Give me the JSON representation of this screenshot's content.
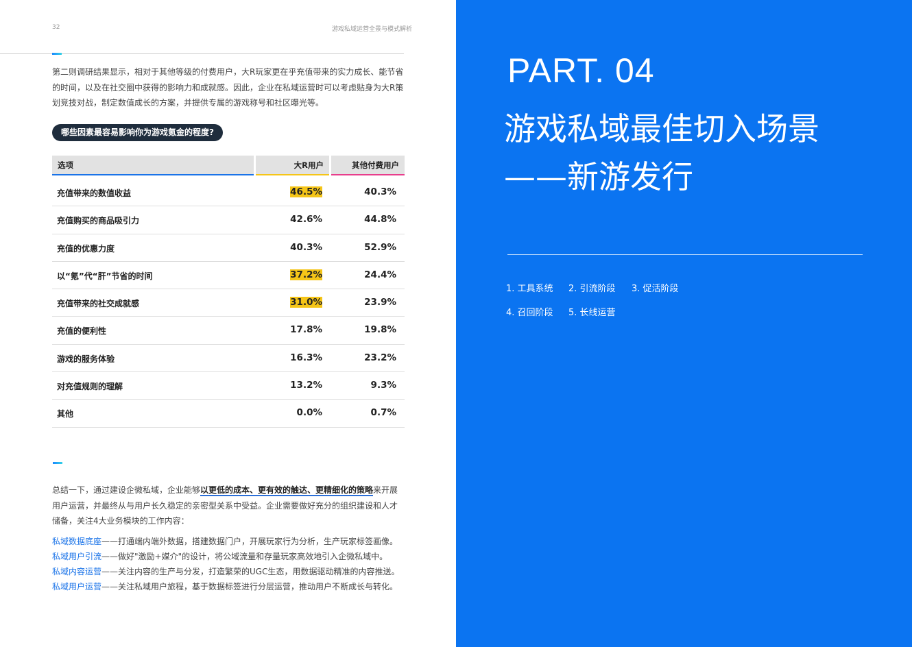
{
  "header": {
    "page_number": "32",
    "running_title": "游戏私域运营全景与模式解析"
  },
  "intro_paragraph": {
    "line1": "第二则调研结果显示，相对于其他等级的付费用户，大R玩家更在乎充值带来的实力成长、能节省",
    "line2": "的时间，以及在社交圈中获得的影响力和成就感。因此，企业在私域运营时可以考虑贴身为大R策",
    "line3": "划竞技对战，制定数值成长的方案，并提供专属的游戏称号和社区曝光等。"
  },
  "question_pill": "哪些因素最容易影响你为游戏氪金的程度?",
  "table": {
    "headers": {
      "option": "选项",
      "big_r": "大R用户",
      "other": "其他付费用户"
    },
    "rows": [
      {
        "option": "充值带来的数值收益",
        "big_r": "46.5%",
        "other": "40.3%",
        "highlight": true
      },
      {
        "option": "充值购买的商品吸引力",
        "big_r": "42.6%",
        "other": "44.8%",
        "highlight": false
      },
      {
        "option": "充值的优惠力度",
        "big_r": "40.3%",
        "other": "52.9%",
        "highlight": false
      },
      {
        "option": "以“氪”代“肝”节省的时间",
        "big_r": "37.2%",
        "other": "24.4%",
        "highlight": true
      },
      {
        "option": "充值带来的社交成就感",
        "big_r": "31.0%",
        "other": "23.9%",
        "highlight": true
      },
      {
        "option": "充值的便利性",
        "big_r": "17.8%",
        "other": "19.8%",
        "highlight": false
      },
      {
        "option": "游戏的服务体验",
        "big_r": "16.3%",
        "other": "23.2%",
        "highlight": false
      },
      {
        "option": "对充值规则的理解",
        "big_r": "13.2%",
        "other": "9.3%",
        "highlight": false
      },
      {
        "option": "其他",
        "big_r": "0.0%",
        "other": "0.7%",
        "highlight": false
      }
    ],
    "highlight_color": "#f5c518"
  },
  "summary": {
    "pre": "总结一下，通过建设企微私域，企业能够",
    "emphasis": "以更低的成本、更有效的触达、更精细化的策略",
    "post": "来开展",
    "line2": "用户运营，并最终从与用户长久稳定的亲密型关系中受益。企业需要做好充分的组织建设和人才",
    "line3": "储备，关注4大业务模块的工作内容："
  },
  "modules": [
    {
      "key": "私域数据底座",
      "text": "——打通端内端外数据，搭建数据门户，开展玩家行为分析，生产玩家标签画像。"
    },
    {
      "key": "私域用户引流",
      "text": "——做好\"激励+媒介\"的设计，将公域流量和存量玩家高效地引入企微私域中。"
    },
    {
      "key": "私域内容运营",
      "text": "——关注内容的生产与分发，打造繁荣的UGC生态，用数据驱动精准的内容推送。"
    },
    {
      "key": "私域用户运营",
      "text": "——关注私域用户旅程，基于数据标签进行分层运营，推动用户不断成长与转化。"
    }
  ],
  "right_panel": {
    "part": "PART. 04",
    "title_line1": "游戏私域最佳切入场景",
    "title_line2": "——新游发行",
    "toc": [
      "1. 工具系统",
      "2. 引流阶段",
      "3. 促活阶段",
      "4. 召回阶段",
      "5. 长线运营"
    ],
    "background_color": "#0b74f1"
  }
}
